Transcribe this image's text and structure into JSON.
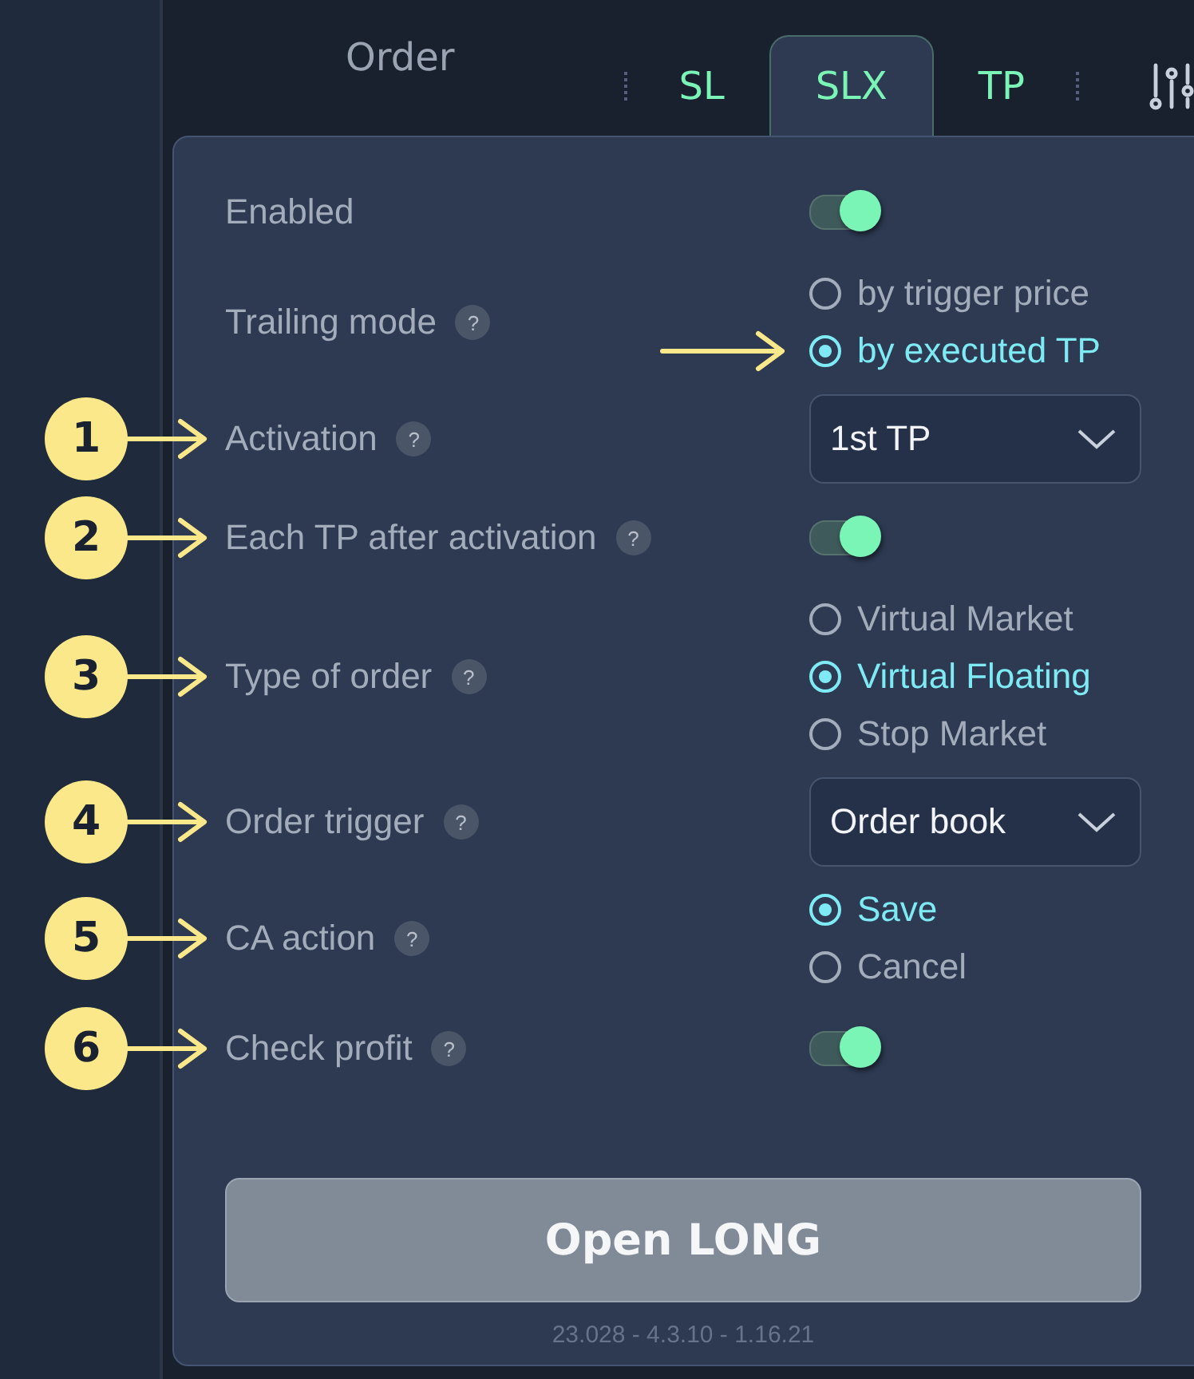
{
  "tabs": [
    {
      "label": "Order",
      "kind": "main",
      "selected": false
    },
    {
      "label": "SL",
      "kind": "sub",
      "selected": false
    },
    {
      "label": "SLX",
      "kind": "sub",
      "selected": true
    },
    {
      "label": "TP",
      "kind": "sub",
      "selected": false
    }
  ],
  "rows": [
    {
      "label": "Enabled",
      "help": false,
      "kind": "toggle",
      "on": true
    },
    {
      "label": "Trailing mode",
      "help": true,
      "kind": "radio",
      "options": [
        {
          "label": "by trigger price",
          "selected": false,
          "pointer": false
        },
        {
          "label": "by executed TP",
          "selected": true,
          "pointer": true
        }
      ]
    },
    {
      "label": "Activation",
      "help": true,
      "callout": "1",
      "kind": "select",
      "value": "1st TP"
    },
    {
      "label": "Each TP after activation",
      "help": true,
      "callout": "2",
      "kind": "toggle",
      "on": true
    },
    {
      "label": "Type of order",
      "help": true,
      "callout": "3",
      "kind": "radio",
      "options": [
        {
          "label": "Virtual Market",
          "selected": false,
          "pointer": false
        },
        {
          "label": "Virtual Floating",
          "selected": true,
          "pointer": false
        },
        {
          "label": "Stop Market",
          "selected": false,
          "pointer": false
        }
      ]
    },
    {
      "label": "Order trigger",
      "help": true,
      "callout": "4",
      "kind": "select",
      "value": "Order book"
    },
    {
      "label": "CA action",
      "help": true,
      "callout": "5",
      "kind": "radio",
      "options": [
        {
          "label": "Save",
          "selected": true,
          "pointer": false
        },
        {
          "label": "Cancel",
          "selected": false,
          "pointer": false
        }
      ]
    },
    {
      "label": "Check profit",
      "help": true,
      "callout": "6",
      "kind": "toggle",
      "on": true
    }
  ],
  "help_mark": "?",
  "button": "Open LONG",
  "version": "23.028 - 4.3.10 - 1.16.21"
}
